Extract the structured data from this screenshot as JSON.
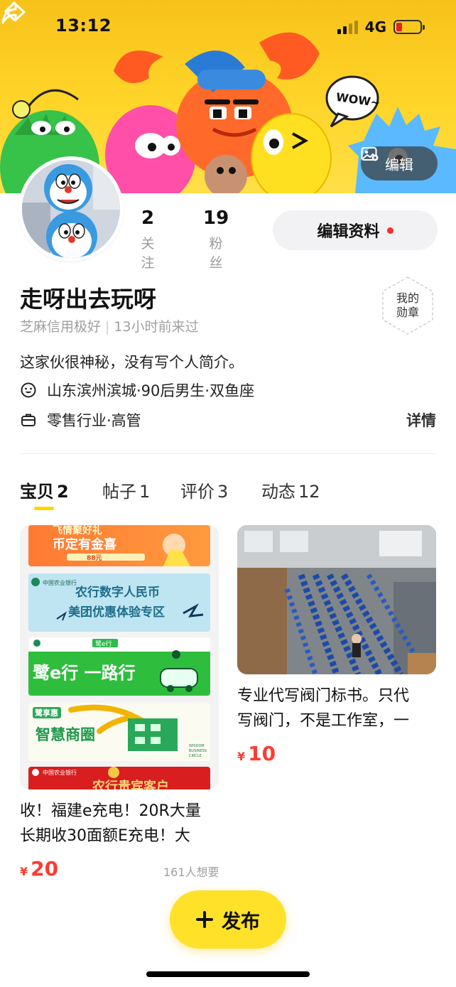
{
  "status_bar": {
    "time": "13:12",
    "network": "4G",
    "battery_level": 0.25
  },
  "header": {
    "edit_cover_label": "编辑"
  },
  "profile": {
    "following": {
      "count": "2",
      "label": "关注"
    },
    "followers": {
      "count": "19",
      "label": "粉丝"
    },
    "edit_profile_label": "编辑资料",
    "nickname": "走呀出去玩呀",
    "credit": "芝麻信用极好",
    "last_seen": "13小时前来过",
    "badge_line1": "我的",
    "badge_line2": "勋章",
    "bio": "这家伙很神秘，没有写个人简介。",
    "location_info": "山东滨州滨城·90后男生·双鱼座",
    "job_info": "零售行业·高管",
    "details_label": "详情"
  },
  "tabs": [
    {
      "label": "宝贝",
      "count": "2"
    },
    {
      "label": "帖子",
      "count": "1"
    },
    {
      "label": "评价",
      "count": "3"
    },
    {
      "label": "动态",
      "count": "12"
    }
  ],
  "items": [
    {
      "title_line1": "收！福建e充电！20R大量",
      "title_line2": "长期收30面额E充电！大",
      "currency": "¥",
      "price": "20",
      "wants": "161人想要",
      "image_text": {
        "b1_line1": "币定有金喜",
        "b1_top": "飞情聚好礼",
        "b1_small": "88元",
        "b2_bank": "中国农业银行",
        "b2_line1": "农行数字人民币",
        "b2_line2": "美团优惠体验专区",
        "b3_main": "鹭e行 一路行",
        "b3_small": "鹭e行",
        "b4_logo": "鹭享惠",
        "b4_main": "智慧商圈",
        "b4_en1": "WISDOM",
        "b4_en2": "BUSINESS",
        "b4_en3": "CIRCLE",
        "b5_bank": "中国农业银行",
        "b5_main": "农行贵宾客户"
      }
    },
    {
      "title_line1": "专业代写阀门标书。只代",
      "title_line2": "写阀门，不是工作室，一",
      "currency": "¥",
      "price": "10"
    }
  ],
  "publish_label": "发布",
  "banner_text": {
    "wow": "WOW~"
  },
  "colors": {
    "accent": "#ffe12a",
    "price": "#ff3b30",
    "banner_bg": "#ffd52a"
  }
}
